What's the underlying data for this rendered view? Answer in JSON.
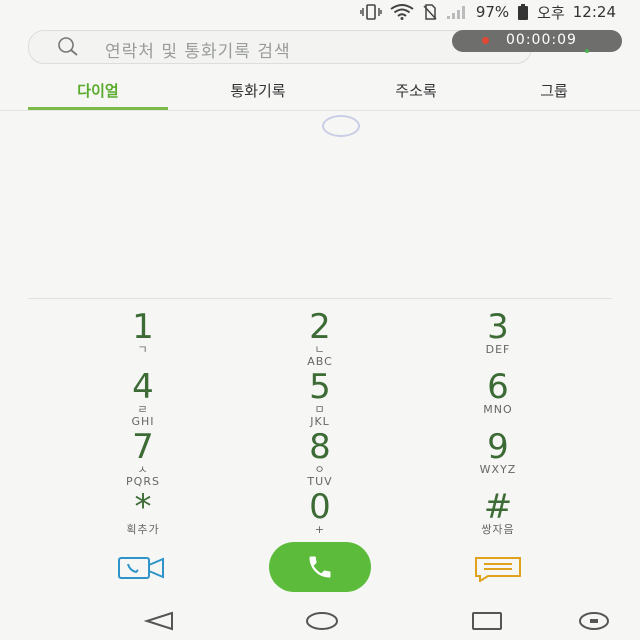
{
  "status_bar": {
    "battery_percent": "97%",
    "ampm": "오후",
    "time": "12:24"
  },
  "search": {
    "placeholder": "연락처 및 통화기록 검색"
  },
  "call_timer": {
    "text": "00:00:09",
    "indicator_color": "#e04834"
  },
  "tabs": [
    {
      "label": "다이얼",
      "active": true
    },
    {
      "label": "통화기록",
      "active": false
    },
    {
      "label": "주소록",
      "active": false
    },
    {
      "label": "그룹",
      "active": false
    }
  ],
  "accent_color": "#5cbb3b",
  "keypad": [
    {
      "digit": "1",
      "jamo": "ㄱ",
      "letters": ""
    },
    {
      "digit": "2",
      "jamo": "ㄴ",
      "letters": "ABC"
    },
    {
      "digit": "3",
      "jamo": "",
      "letters": "DEF"
    },
    {
      "digit": "4",
      "jamo": "ㄹ",
      "letters": "GHI"
    },
    {
      "digit": "5",
      "jamo": "ㅁ",
      "letters": "JKL"
    },
    {
      "digit": "6",
      "jamo": "",
      "letters": "MNO"
    },
    {
      "digit": "7",
      "jamo": "ㅅ",
      "letters": "PQRS"
    },
    {
      "digit": "8",
      "jamo": "ㅇ",
      "letters": "TUV"
    },
    {
      "digit": "9",
      "jamo": "",
      "letters": "WXYZ"
    },
    {
      "digit": "*",
      "jamo": "",
      "letters": "획추가"
    },
    {
      "digit": "0",
      "jamo": "",
      "letters": "+"
    },
    {
      "digit": "#",
      "jamo": "",
      "letters": "쌍자음"
    }
  ],
  "actions": {
    "video_call_icon": "video-call-icon",
    "call_icon": "phone-icon",
    "message_icon": "message-icon"
  },
  "nav_bar": {
    "icons": [
      "back-icon",
      "home-icon",
      "recents-icon",
      "extra-icon"
    ]
  }
}
